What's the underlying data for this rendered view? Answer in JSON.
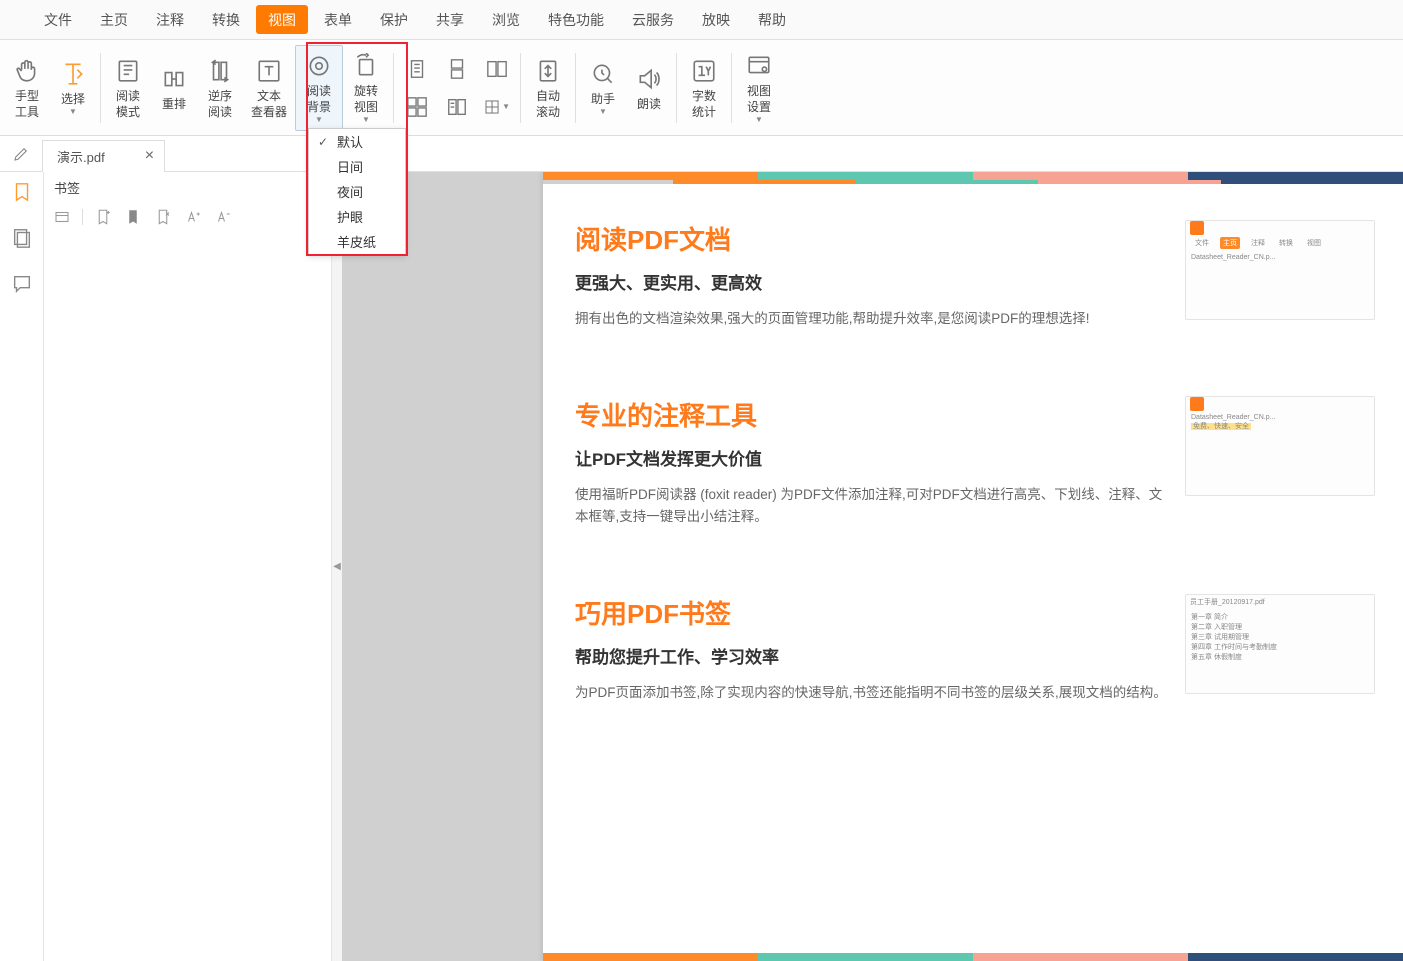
{
  "menu": {
    "items": [
      "文件",
      "主页",
      "注释",
      "转换",
      "视图",
      "表单",
      "保护",
      "共享",
      "浏览",
      "特色功能",
      "云服务",
      "放映",
      "帮助"
    ],
    "active_index": 4
  },
  "ribbon": {
    "hand_tool": "手型\n工具",
    "select": "选择",
    "read_mode": "阅读\n模式",
    "reflow": "重排",
    "reverse_read": "逆序\n阅读",
    "text_viewer": "文本\n查看器",
    "read_bg": "阅读\n背景",
    "rotate_view": "旋转\n视图",
    "auto_scroll": "自动\n滚动",
    "assistant": "助手",
    "read_aloud": "朗读",
    "word_count": "字数\n统计",
    "view_settings": "视图\n设置"
  },
  "bg_menu": {
    "items": [
      "默认",
      "日间",
      "夜间",
      "护眼",
      "羊皮纸"
    ],
    "checked_index": 0
  },
  "tab": {
    "title": "演示.pdf",
    "close": "×"
  },
  "bookmarks": {
    "title": "书签"
  },
  "doc": {
    "s1": {
      "h": "阅读PDF文档",
      "sub": "更强大、更实用、更高效",
      "p": "拥有出色的文档渲染效果,强大的页面管理功能,帮助提升效率,是您阅读PDF的理想选择!"
    },
    "s2": {
      "h": "专业的注释工具",
      "sub": "让PDF文档发挥更大价值",
      "p": "使用福昕PDF阅读器 (foxit reader) 为PDF文件添加注释,可对PDF文档进行高亮、下划线、注释、文本框等,支持一键导出小结注释。"
    },
    "s3": {
      "h": "巧用PDF书签",
      "sub": "帮助您提升工作、学习效率",
      "p": "为PDF页面添加书签,除了实现内容的快速导航,书签还能指明不同书签的层级关系,展现文档的结构。"
    },
    "thumb": {
      "tabs": [
        "文件",
        "主页",
        "注释",
        "转换",
        "视图"
      ],
      "file1": "Datasheet_Reader_CN.p...",
      "file2": "员工手册_20120917.pdf",
      "hl": "免费、快速、安全",
      "bm": [
        "第一章 简介",
        "第二章 入职管理",
        "第三章 试用期管理",
        "第四章 工作时间与考勤制度",
        "第五章 休假制度"
      ]
    }
  }
}
